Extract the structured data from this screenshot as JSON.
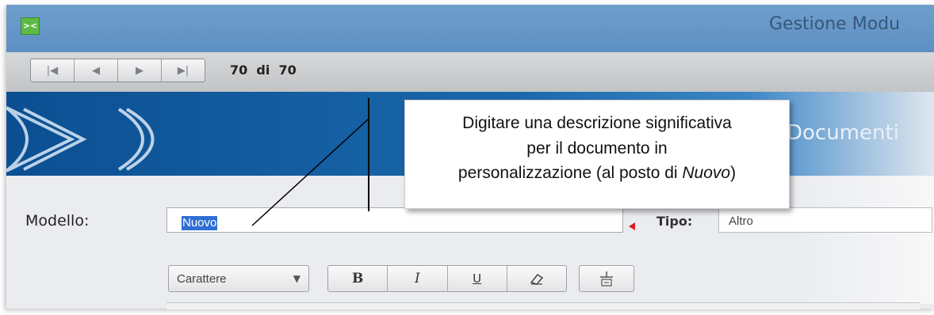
{
  "window": {
    "title": "Gestione Modu",
    "logo_text": "><"
  },
  "navigation": {
    "first_icon": "first-record-icon",
    "prev_icon": "previous-record-icon",
    "next_icon": "next-record-icon",
    "last_icon": "last-record-icon",
    "first_glyph": "|◀",
    "prev_glyph": "◀",
    "next_glyph": "▶",
    "last_glyph": "▶|",
    "counter": "70  di  70"
  },
  "banner": {
    "section_title": "Documenti"
  },
  "form": {
    "modello_label": "Modello:",
    "modello_value": "Nuovo",
    "tipo_label": "Tipo:",
    "tipo_value": "Altro"
  },
  "toolbar": {
    "font_select_value": "Carattere",
    "bold_label": "B",
    "italic_label": "I",
    "underline_label": "U",
    "eraser_icon": "eraser-icon",
    "page_icon": "page-break-icon"
  },
  "callout": {
    "line1": "Digitare una descrizione significativa",
    "line2": "per il documento in",
    "line3_prefix": "personalizzazione (al posto di ",
    "line3_em": "Nuovo",
    "line3_suffix": ")"
  },
  "colors": {
    "titlebar": "#6a9acb",
    "banner": "#0b4f92",
    "selection": "#2f6ed5",
    "required": "#d52020"
  }
}
